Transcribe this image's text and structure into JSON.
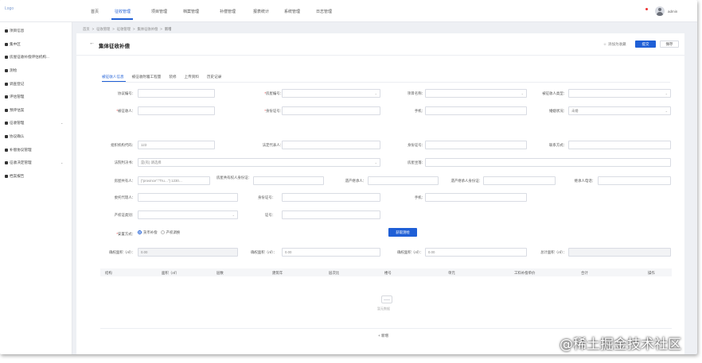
{
  "topnav": {
    "logo": "Logo",
    "items": [
      "首页",
      "征收管理",
      "项目管理",
      "档案管理",
      "补偿管理",
      "报表统计",
      "系统管理",
      "日志管理"
    ],
    "active_index": 1,
    "user": "admin"
  },
  "sidebar": {
    "items": [
      {
        "label": "项目信息"
      },
      {
        "label": "集中区"
      },
      {
        "label": "房屋征收补偿评估机构..."
      },
      {
        "label": "测绘"
      },
      {
        "label": "调查登记"
      },
      {
        "label": "评估管理"
      },
      {
        "label": "预评估案"
      },
      {
        "label": "征收管理",
        "chevron": "⌄"
      },
      {
        "label": "协议确认"
      },
      {
        "label": "补偿协议管理"
      },
      {
        "label": "征收决定管理",
        "chevron": "⌄"
      },
      {
        "label": "档案报告"
      }
    ]
  },
  "breadcrumb": [
    "首页",
    "征收管理",
    "征收管理",
    "集体征收补偿",
    "新增"
  ],
  "page": {
    "title": "集体征收补偿",
    "back": "←",
    "star_label": "添加为收藏",
    "save_label": "提交",
    "cancel_label": "保存"
  },
  "tabs": [
    "被征收人信息",
    "被征收附着工程量",
    "装修",
    "上传资料",
    "历史记录"
  ],
  "form": {
    "row1": [
      {
        "label": "协议编号：",
        "value": ""
      },
      {
        "label": "房屋编号：",
        "req": "*",
        "value": "",
        "select": true
      },
      {
        "label": "项目名称：",
        "value": "",
        "select": true
      },
      {
        "label": "被征收人类型：",
        "value": "",
        "select": true
      }
    ],
    "row2": [
      {
        "label": "被征收人：",
        "req": "*",
        "value": ""
      },
      {
        "label": "身份证号：",
        "req": "*",
        "value": ""
      },
      {
        "label": "手机：",
        "value": ""
      },
      {
        "label": "婚姻状况：",
        "value": "未婚",
        "select": true
      }
    ],
    "row3": [
      {
        "label": "组织机构代码：",
        "value": "123"
      },
      {
        "label": "法定代表人：",
        "value": ""
      },
      {
        "label": "身份证号：",
        "value": ""
      },
      {
        "label": "联系方式：",
        "value": ""
      }
    ],
    "row4": [
      {
        "label": "法院判决书：",
        "value": "是(有)  请选择",
        "select": true
      },
      {
        "label": "房屋坐落：",
        "value": ""
      }
    ],
    "row5": [
      {
        "label": "房屋共有人：",
        "value": "{\"province\":\"Tru…\"} 1230…"
      },
      {
        "label": "房屋共有权人身份证：",
        "value": ""
      },
      {
        "label": "遗产继承人：",
        "value": ""
      },
      {
        "label": "遗产继承人身份证：",
        "value": ""
      },
      {
        "label": "继承人电话：",
        "value": ""
      }
    ],
    "row6": [
      {
        "label": "委托代理人：",
        "value": ""
      },
      {
        "label": "身份证号：",
        "value": ""
      },
      {
        "label": "手机：",
        "value": ""
      }
    ],
    "row7": [
      {
        "label": "产权证类别：",
        "value": "",
        "select": true
      },
      {
        "label": "证号：",
        "value": ""
      }
    ],
    "placement": {
      "label": "安置方式：",
      "req": "*",
      "options": [
        "货币补偿",
        "产权调换"
      ],
      "selected": 0,
      "calc_button": "获取测绘"
    },
    "row8": [
      {
        "label": "确权面积（㎡）：",
        "value": "0.00"
      },
      {
        "label": "确权面积（㎡）：",
        "value": "0.00"
      },
      {
        "label": "确权面积（㎡）：",
        "value": "0.00"
      },
      {
        "label": "总计面积（㎡）：",
        "value": ""
      }
    ]
  },
  "table": {
    "headers": [
      "结构",
      "面积（㎡）",
      "层数",
      "建筑年",
      "层次比",
      "楼号",
      "单元",
      "工料补偿单价",
      "合计",
      "操作"
    ],
    "empty_text": "暂无数据",
    "add_label": "+ 新增"
  },
  "watermark": "@稀土掘金技术社区"
}
